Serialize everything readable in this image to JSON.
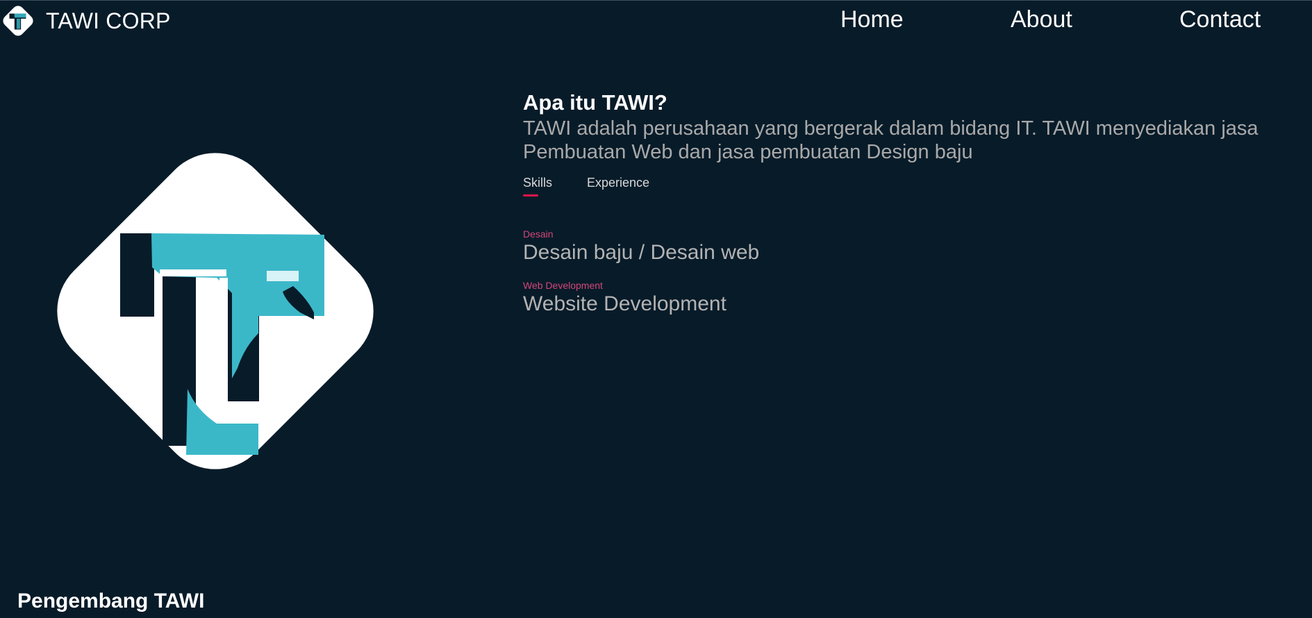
{
  "header": {
    "brand": "TAWI CORP",
    "nav": {
      "home": "Home",
      "about": "About",
      "contact": "Contact"
    }
  },
  "about": {
    "title": "Apa itu TAWI?",
    "description": "TAWI adalah perusahaan yang bergerak dalam bidang IT. TAWI menyediakan jasa Pembuatan Web dan jasa pembuatan Design baju"
  },
  "tabs": {
    "skills": "Skills",
    "experience": "Experience"
  },
  "skills": [
    {
      "category": "Desain",
      "title": "Desain baju / Desain web"
    },
    {
      "category": "Web Development",
      "title": "Website Development"
    }
  ],
  "developers": {
    "title": "Pengembang TAWI"
  },
  "colors": {
    "background": "#081b29",
    "accent": "#e3154b",
    "logo_teal": "#3bb8c8"
  }
}
